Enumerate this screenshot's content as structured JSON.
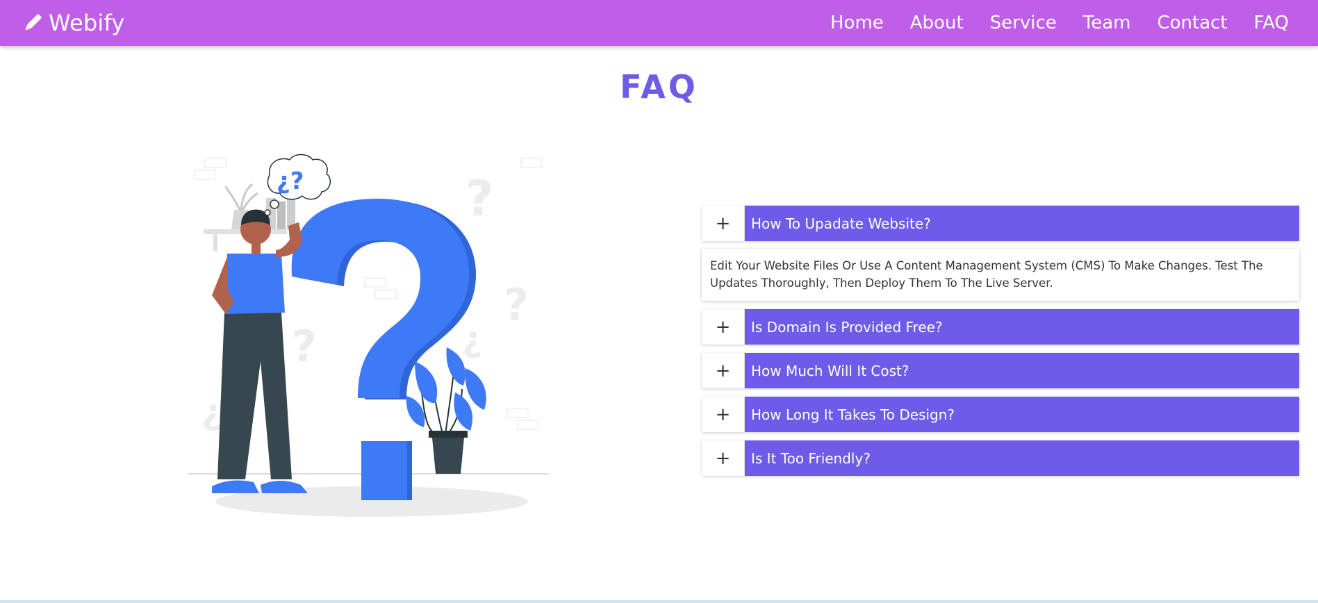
{
  "brand": {
    "name": "Webify",
    "icon": "pencil-icon"
  },
  "nav": {
    "items": [
      {
        "label": "Home"
      },
      {
        "label": "About"
      },
      {
        "label": "Service"
      },
      {
        "label": "Team"
      },
      {
        "label": "Contact"
      },
      {
        "label": "FAQ"
      }
    ]
  },
  "faq": {
    "title": "FAQ",
    "items": [
      {
        "toggle": "+",
        "question": "How To Upadate Website?",
        "expanded": true,
        "answer": "Edit Your Website Files Or Use A Content Management System (CMS) To Make Changes. Test The Updates Thoroughly, Then Deploy Them To The Live Server."
      },
      {
        "toggle": "+",
        "question": "Is Domain Is Provided Free?",
        "expanded": false
      },
      {
        "toggle": "+",
        "question": "How Much Will It Cost?",
        "expanded": false
      },
      {
        "toggle": "+",
        "question": "How Long It Takes To Design?",
        "expanded": false
      },
      {
        "toggle": "+",
        "question": "Is It Too Friendly?",
        "expanded": false
      }
    ]
  },
  "illustration": {
    "bubble_text": "¿?"
  },
  "colors": {
    "navbar": "#bf5ee6",
    "accent": "#6c5ce7",
    "illustration_blue": "#3f7af6"
  }
}
